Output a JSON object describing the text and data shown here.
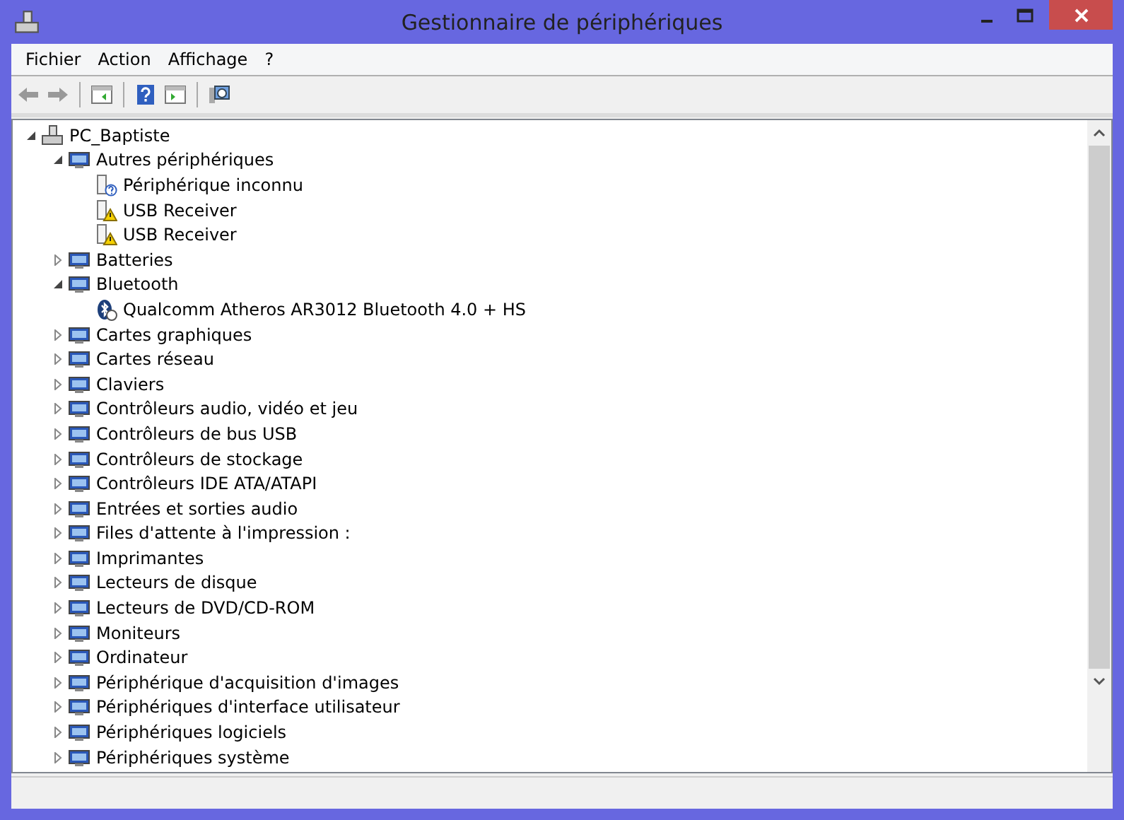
{
  "window": {
    "title": "Gestionnaire de périphériques"
  },
  "menu": [
    "Fichier",
    "Action",
    "Affichage",
    "?"
  ],
  "tree": {
    "label": "PC_Baptiste",
    "expanded": true,
    "children": [
      {
        "label": "Autres périphériques",
        "expanded": true,
        "children": [
          {
            "label": "Périphérique inconnu",
            "kind": "unknown"
          },
          {
            "label": "USB Receiver",
            "kind": "warning"
          },
          {
            "label": "USB Receiver",
            "kind": "warning"
          }
        ]
      },
      {
        "label": "Batteries",
        "expanded": false
      },
      {
        "label": "Bluetooth",
        "expanded": true,
        "children": [
          {
            "label": "Qualcomm Atheros AR3012 Bluetooth 4.0 + HS",
            "kind": "bluetooth"
          }
        ]
      },
      {
        "label": "Cartes graphiques",
        "expanded": false
      },
      {
        "label": "Cartes réseau",
        "expanded": false
      },
      {
        "label": "Claviers",
        "expanded": false
      },
      {
        "label": "Contrôleurs audio, vidéo et jeu",
        "expanded": false
      },
      {
        "label": "Contrôleurs de bus USB",
        "expanded": false
      },
      {
        "label": "Contrôleurs de stockage",
        "expanded": false
      },
      {
        "label": "Contrôleurs IDE ATA/ATAPI",
        "expanded": false
      },
      {
        "label": "Entrées et sorties audio",
        "expanded": false
      },
      {
        "label": "Files d'attente à l'impression :",
        "expanded": false
      },
      {
        "label": "Imprimantes",
        "expanded": false
      },
      {
        "label": "Lecteurs de disque",
        "expanded": false
      },
      {
        "label": "Lecteurs de DVD/CD-ROM",
        "expanded": false
      },
      {
        "label": "Moniteurs",
        "expanded": false
      },
      {
        "label": "Ordinateur",
        "expanded": false
      },
      {
        "label": "Périphérique d'acquisition d'images",
        "expanded": false
      },
      {
        "label": "Périphériques d'interface utilisateur",
        "expanded": false
      },
      {
        "label": "Périphériques logiciels",
        "expanded": false
      },
      {
        "label": "Périphériques système",
        "expanded": false
      }
    ]
  }
}
